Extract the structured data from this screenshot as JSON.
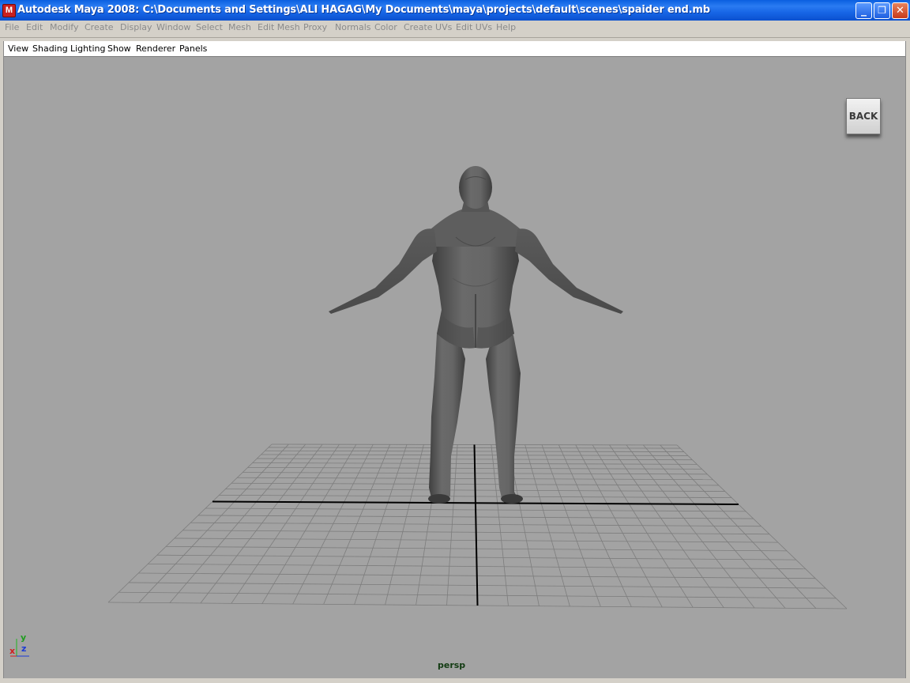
{
  "window": {
    "title": "Autodesk Maya 2008: C:\\Documents and Settings\\ALI HAGAG\\My Documents\\maya\\projects\\default\\scenes\\spaider end.mb",
    "app_icon_glyph": "M",
    "controls": {
      "minimize": "_",
      "restore": "❐",
      "close": "✕"
    }
  },
  "main_menu": [
    "File",
    "Edit",
    "Modify",
    "Create",
    "Display",
    "Window",
    "Select",
    "Mesh",
    "Edit Mesh",
    "Proxy",
    "Normals",
    "Color",
    "Create UVs",
    "Edit UVs",
    "Help"
  ],
  "panel_menu": [
    "View",
    "Shading",
    "Lighting",
    "Show",
    "Renderer",
    "Panels"
  ],
  "viewport": {
    "back_button": "BACK",
    "camera": "persp",
    "axes": {
      "x": "x",
      "y": "y",
      "z": "z"
    },
    "colors": {
      "background": "#a3a3a3",
      "grid": "#7d7d7d",
      "axis_line": "#000000",
      "model": "#5c5c5c"
    }
  }
}
